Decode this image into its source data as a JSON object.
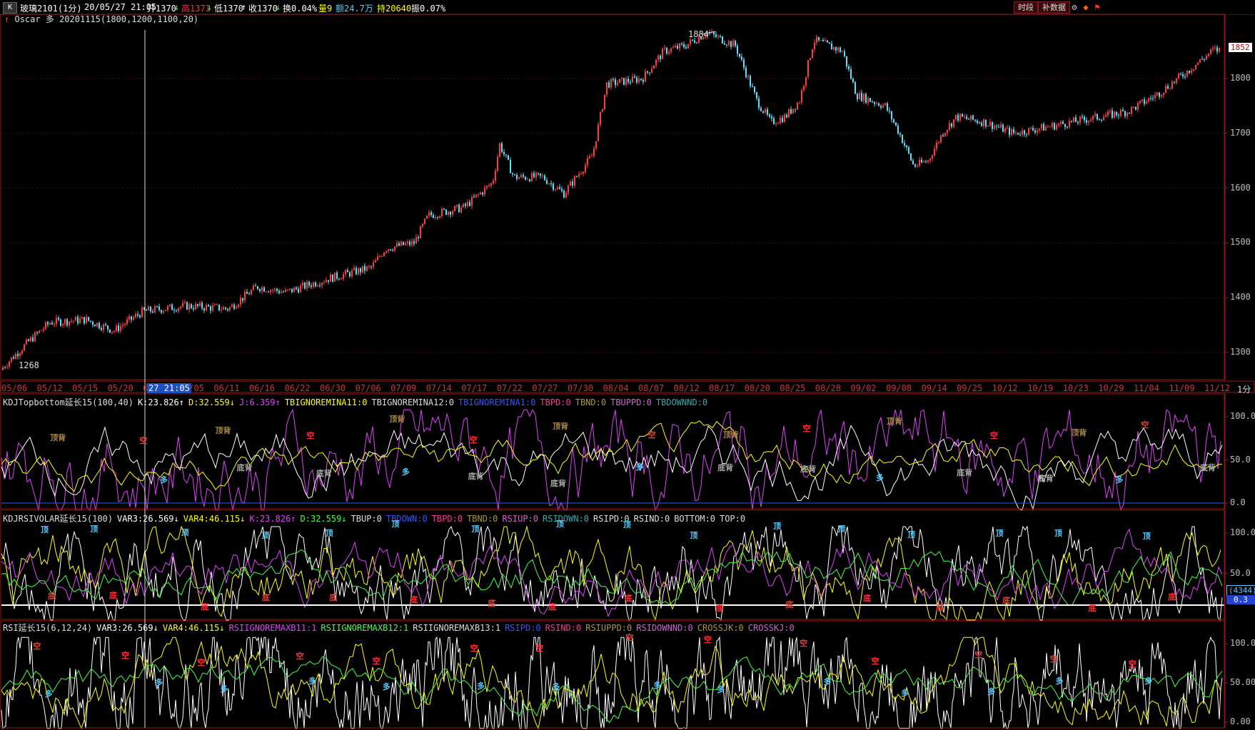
{
  "topbar": {
    "symbol": "玻璃2101(1分)",
    "datetime": "20/05/27 21:05",
    "open": "开1370",
    "open_arrow": "↓",
    "high": "高1371",
    "high_arrow": "↓",
    "low": "低1370",
    "low_arrow": "↑",
    "close": "收1370",
    "close_arrow": "↓",
    "turnover": "换0.04%",
    "volume": "量9",
    "amount": "额24.7万",
    "hold": "持20640",
    "amplitude": "振0.07%",
    "btn_period": "时段",
    "btn_fill": "补数据",
    "k_label": "K"
  },
  "strategy": {
    "arrow": "↑",
    "name": "Oscar",
    "direction": "多",
    "params": "20201115(1800,1200,1100,20)"
  },
  "main_chart": {
    "high_label": "1884",
    "low_label": "1268",
    "last_price": "1852",
    "y_ticks": [
      "1800",
      "1700",
      "1600",
      "1500",
      "1400",
      "1300"
    ],
    "period_label": "1分",
    "colors": {
      "up": "#ff3b3b",
      "down": "#58e1ff",
      "grid": "#3b0d0d",
      "axis": "#8b1a1a"
    }
  },
  "date_axis": {
    "ticks": [
      "05/06",
      "05/12",
      "05/15",
      "05/20",
      "05/",
      "06/05",
      "06/11",
      "06/16",
      "06/22",
      "06/30",
      "07/06",
      "07/09",
      "07/14",
      "07/17",
      "07/22",
      "07/27",
      "07/30",
      "08/04",
      "08/07",
      "08/12",
      "08/17",
      "08/20",
      "08/25",
      "08/28",
      "09/02",
      "09/08",
      "09/14",
      "09/25",
      "10/12",
      "10/19",
      "10/23",
      "10/29",
      "11/04",
      "11/09",
      "11/12"
    ],
    "cursor_label": "27 21:05"
  },
  "panel1": {
    "name": "KDJTopbottom延长15(100,40)",
    "k": "K:23.826",
    "k_arrow": "↑",
    "d": "D:32.559",
    "d_arrow": "↓",
    "j": "J:6.359",
    "j_arrow": "↑",
    "f1": "TBIGNOREMINA11:0",
    "f2": "TBIGNOREMINA12:0",
    "f3": "TBIGNOREMINA1:0",
    "f4": "TBPD:0",
    "f5": "TBND:0",
    "f6": "TBUPPD:0",
    "f7": "TBDOWNND:0",
    "y_ticks": [
      "100.0",
      "50.0",
      "0.0"
    ]
  },
  "panel2": {
    "name": "KDJRSIVOLAR延长15(100)",
    "var3": "VAR3:26.569",
    "var3_arrow": "↓",
    "var4": "VAR4:46.115",
    "var4_arrow": "↓",
    "k": "K:23.826",
    "k_arrow": "↑",
    "d": "D:32.559",
    "d_arrow": "↓",
    "f1": "TBUP:0",
    "f2": "TBDOWN:0",
    "f3": "TBPD:0",
    "f4": "TBND:0",
    "f5": "RSIUP:0",
    "f6": "RSIDOWN:0",
    "f7": "RSIPD:0",
    "f8": "RSIND:0",
    "f9": "BOTTOM:0",
    "f10": "TOP:0",
    "y_ticks": [
      "100.0",
      "50.0"
    ],
    "badge1": "(4344)",
    "badge2": "0.3"
  },
  "panel3": {
    "name": "RSI延长15(6,12,24)",
    "var3": "VAR3:26.569",
    "var3_arrow": "↓",
    "var4": "VAR4:46.115",
    "var4_arrow": "↓",
    "f1": "RSIIGNOREMAXB11:1",
    "f2": "RSIIGNOREMAXB12:1",
    "f3": "RSIIGNOREMAXB13:1",
    "f4": "RSIPD:0",
    "f5": "RSIND:0",
    "f6": "RSIUPPD:0",
    "f7": "RSIDOWNND:0",
    "f8": "CROSSJK:0",
    "f9": "CROSSKJ:0",
    "y_ticks": [
      "100.00",
      "50.00",
      "0.00"
    ]
  },
  "signals": {
    "top": "顶",
    "bottom": "底",
    "empty": "空",
    "long": "多",
    "bottom_div": "底背",
    "top_div": "顶背"
  }
}
